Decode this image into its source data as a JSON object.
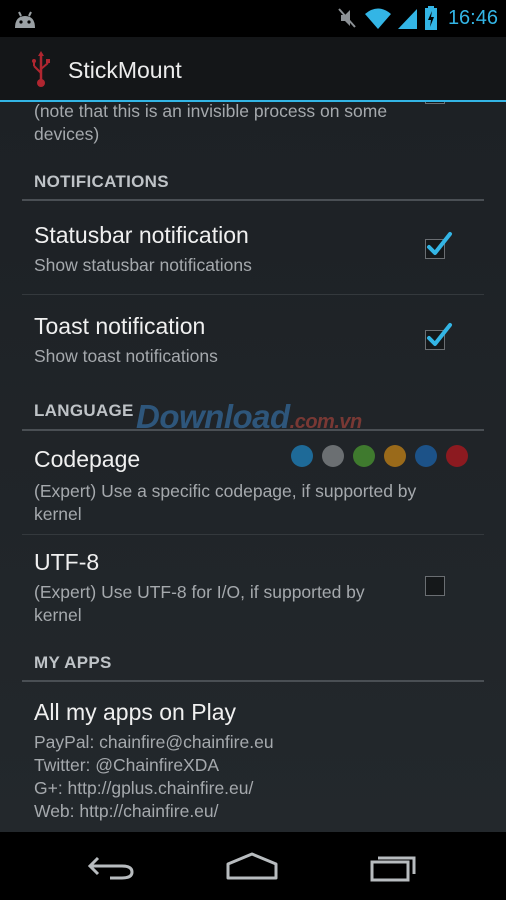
{
  "status_bar": {
    "time": "16:46",
    "icons": [
      "android-icon",
      "mute-icon",
      "wifi-icon",
      "signal-icon",
      "battery-charging-icon"
    ],
    "accent_color": "#33b5e5"
  },
  "action_bar": {
    "title": "StickMount",
    "icon": "usb-icon"
  },
  "partial_item": {
    "summary": "(note that this is an invisible process on some devices)"
  },
  "sections": {
    "notifications": "NOTIFICATIONS",
    "language": "LANGUAGE",
    "my_apps": "MY APPS"
  },
  "items": {
    "statusbar": {
      "title": "Statusbar notification",
      "summary": "Show statusbar notifications",
      "checked": true
    },
    "toast": {
      "title": "Toast notification",
      "summary": "Show toast notifications",
      "checked": true
    },
    "codepage": {
      "title": "Codepage",
      "summary": "(Expert) Use a specific codepage, if supported by kernel"
    },
    "utf8": {
      "title": "UTF-8",
      "summary": "(Expert) Use UTF-8 for I/O, if supported by kernel",
      "checked": false
    },
    "my_apps": {
      "title": "All my apps on Play",
      "lines": [
        "PayPal: chainfire@chainfire.eu",
        "Twitter: @ChainfireXDA",
        "G+: http://gplus.chainfire.eu/",
        "Web: http://chainfire.eu/"
      ]
    }
  },
  "watermark": {
    "main": "Download",
    "suffix": ".com.vn"
  },
  "color_dots": [
    "#1e6a98",
    "#6b6f72",
    "#3f7a2e",
    "#9a6a1a",
    "#1c5288",
    "#8c1a20"
  ],
  "nav_bar": {
    "buttons": [
      "back-icon",
      "home-icon",
      "recent-apps-icon"
    ]
  }
}
